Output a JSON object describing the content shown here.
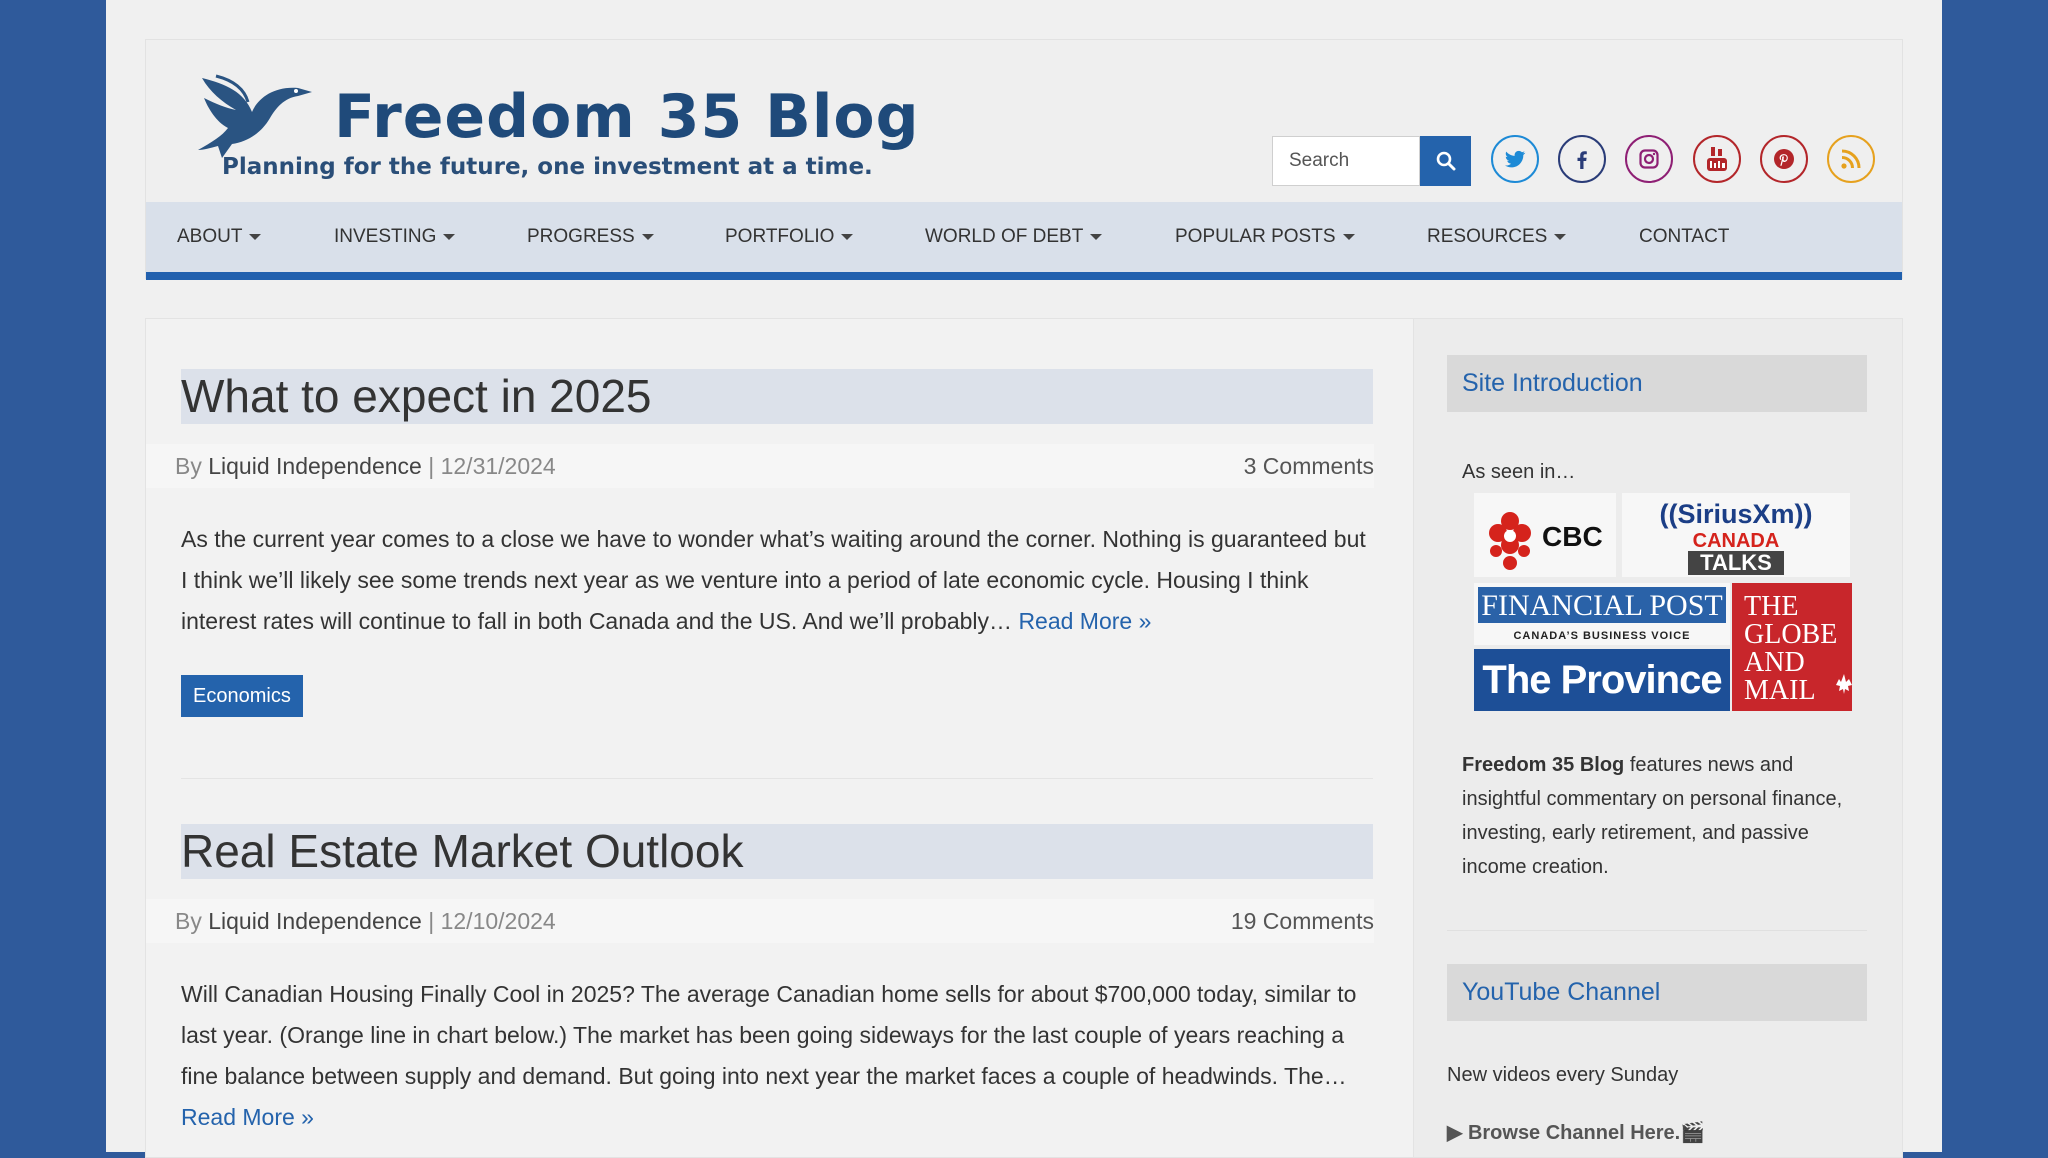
{
  "site": {
    "title": "Freedom 35 Blog",
    "tagline": "Planning for the future, one investment at a time."
  },
  "search": {
    "placeholder": "Search"
  },
  "social": [
    "twitter-icon",
    "facebook-icon",
    "instagram-icon",
    "youtube-icon",
    "pinterest-icon",
    "rss-icon"
  ],
  "nav": {
    "items": [
      {
        "label": "About",
        "dropdown": true
      },
      {
        "label": "Investing",
        "dropdown": true
      },
      {
        "label": "Progress",
        "dropdown": true
      },
      {
        "label": "Portfolio",
        "dropdown": true
      },
      {
        "label": "World of Debt",
        "dropdown": true
      },
      {
        "label": "Popular Posts",
        "dropdown": true
      },
      {
        "label": "Resources",
        "dropdown": true
      },
      {
        "label": "Contact",
        "dropdown": false
      }
    ]
  },
  "posts": [
    {
      "title": "What to expect in 2025",
      "by": "By",
      "author": "Liquid Independence",
      "sep": "|",
      "date": "12/31/2024",
      "comments": "3 Comments",
      "excerpt": "As the current year comes to a close we have to wonder what’s waiting around the corner. Nothing is guaranteed but I think we’ll likely see some trends next year as we venture into a period of late economic cycle. Housing I think interest rates will continue to fall in both Canada and the US. And we’ll probably…",
      "read_more": "Read More »",
      "category": "Economics"
    },
    {
      "title": "Real Estate Market Outlook",
      "by": "By",
      "author": "Liquid Independence",
      "sep": "|",
      "date": "12/10/2024",
      "comments": "19 Comments",
      "excerpt": "Will Canadian Housing Finally Cool in 2025? The average Canadian home sells for about $700,000 today, similar to last year. (Orange line in chart below.) The market has been going sideways for the last couple of years reaching a fine balance between supply and demand. But going into next year the market faces a couple of headwinds. The…",
      "read_more": "Read More »"
    }
  ],
  "sidebar": {
    "intro_title": "Site Introduction",
    "as_seen_in": "As seen in…",
    "logos": {
      "cbc": "CBC",
      "siriusxm": "((SiriusXm))",
      "canada": "CANADA",
      "talks": "TALKS",
      "financial_post": "FINANCIAL POST",
      "fp_sub": "CANADA’S BUSINESS VOICE",
      "province": "The Province",
      "globe": [
        "THE",
        "GLOBE",
        "AND",
        "MAIL"
      ]
    },
    "intro_bold": "Freedom 35 Blog",
    "intro_text": " features news and insightful commentary on personal finance, investing, early retirement, and passive income creation.",
    "youtube_title": "YouTube Channel",
    "youtube_sub": "New videos every Sunday",
    "browse": "▶ Browse Channel Here.🎬"
  },
  "colors": {
    "background": "#2f5a9b",
    "accent": "#2463ac",
    "title_navy": "#1f4a7a",
    "twitter": "#1d8ad6",
    "facebook": "#2a3c78",
    "instagram": "#8e1f74",
    "youtube": "#b3262a",
    "pinterest": "#b3262a",
    "rss": "#e6a11e"
  }
}
